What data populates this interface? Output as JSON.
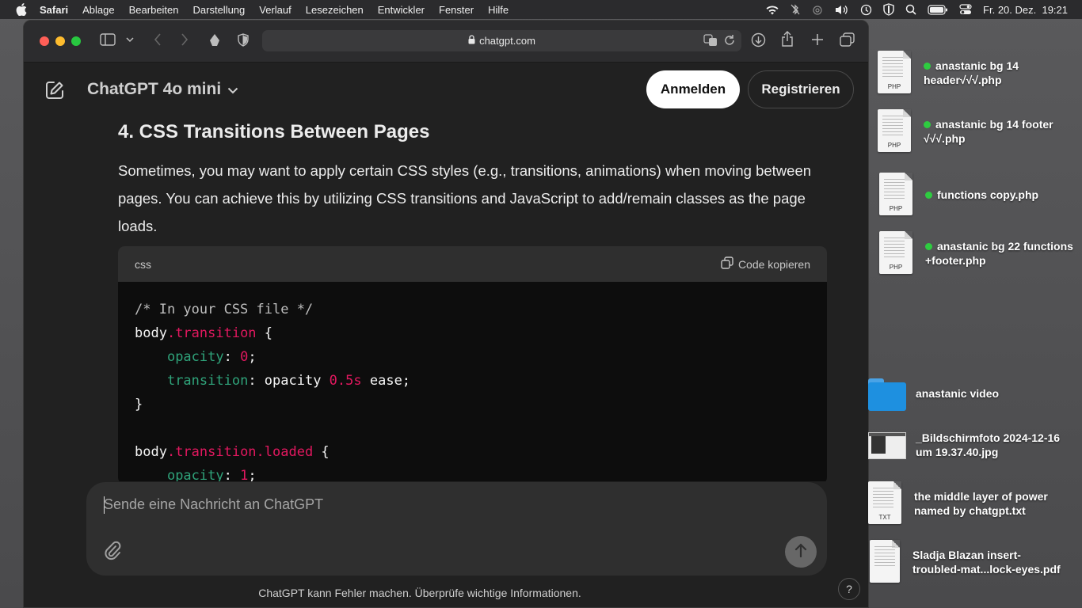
{
  "menubar": {
    "app": "Safari",
    "items": [
      "Ablage",
      "Bearbeiten",
      "Darstellung",
      "Verlauf",
      "Lesezeichen",
      "Entwickler",
      "Fenster",
      "Hilfe"
    ],
    "datetime": "Fr. 20. Dez.  19:21"
  },
  "browser": {
    "url": "chatgpt.com"
  },
  "chat": {
    "model": "ChatGPT 4o mini",
    "login": "Anmelden",
    "register": "Registrieren",
    "heading": "4. CSS Transitions Between Pages",
    "paragraph": "Sometimes, you may want to apply certain CSS styles (e.g., transitions, animations) when moving between pages. You can achieve this by utilizing CSS transitions and JavaScript to add/remain classes as the page loads.",
    "code_lang": "css",
    "copy_label": "Code kopieren",
    "code": {
      "l1": "/* In your CSS file */",
      "l2a": "body",
      "l2b": ".transition",
      "l2c": " {",
      "l3a": "opacity",
      "l3b": ": ",
      "l3c": "0",
      "l3d": ";",
      "l4a": "transition",
      "l4b": ": opacity ",
      "l4c": "0.5s",
      "l4d": " ease;",
      "l5": "}",
      "l7a": "body",
      "l7b": ".transition.loaded",
      "l7c": " {",
      "l8a": "opacity",
      "l8b": ": ",
      "l8c": "1",
      "l8d": ";"
    },
    "composer_placeholder": "Sende eine Nachricht an ChatGPT",
    "disclaimer": "ChatGPT kann Fehler machen. Überprüfe wichtige Informationen.",
    "help": "?"
  },
  "desktop": [
    {
      "name": "anastanic bg 14 header√√√.php",
      "l1": "anastanic bg 14",
      "l2": "header√√√.php",
      "ext": "PHP",
      "tag": "green"
    },
    {
      "name": "anastanic bg 14 footer √√√.php",
      "l1": "anastanic bg 14 footer",
      "l2": "√√√.php",
      "ext": "PHP",
      "tag": "green"
    },
    {
      "name": "functions copy.php",
      "l1": "functions copy.php",
      "l2": "",
      "ext": "PHP",
      "tag": "green"
    },
    {
      "name": "anastanic bg 22 functions +footer.php",
      "l1": "anastanic bg 22 functions",
      "l2": "+footer.php",
      "ext": "PHP",
      "tag": "green"
    },
    {
      "name": "anastanic video",
      "l1": "anastanic video",
      "l2": ""
    },
    {
      "name": "_Bildschirmfoto 2024-12-16 um 19.37.40.jpg",
      "l1": "_Bildschirmfoto 2024-12-16",
      "l2": "um 19.37.40.jpg"
    },
    {
      "name": "the middle layer of power named by chatgpt.txt",
      "l1": "the middle layer of power",
      "l2": "named by chatgpt.txt",
      "ext": "TXT"
    },
    {
      "name": "Sladja Blazan insert-troubled-mat...lock-eyes.pdf",
      "l1": "Sladja Blazan insert-",
      "l2": "troubled-mat...lock-eyes.pdf"
    }
  ],
  "colors": {
    "accent_green": "#2ecc40",
    "code_class": "#e2185f",
    "code_property": "#2fa37a",
    "folder_blue": "#1e90e0"
  }
}
